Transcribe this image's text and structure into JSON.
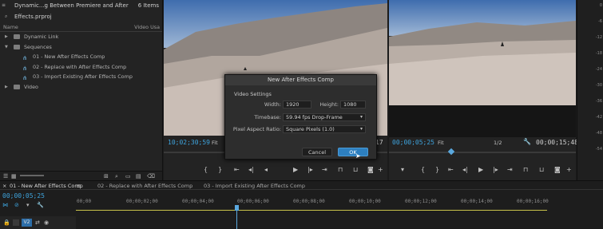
{
  "project": {
    "title": "Dynamic...g Between Premiere and After Effects.prproj",
    "item_count": "6 Items",
    "col_name": "Name",
    "col_usage": "Video Usa",
    "items": [
      {
        "label": "Dynamic Link"
      },
      {
        "label": "Sequences"
      },
      {
        "label": "01 - New After Effects Comp"
      },
      {
        "label": "02 - Replace with After Effects Comp"
      },
      {
        "label": "03 - Import Existing After Effects Comp"
      },
      {
        "label": "Video"
      }
    ]
  },
  "source_monitor": {
    "timecode": "10;02;30;59",
    "fit": "Fit",
    "tail": "17"
  },
  "program_monitor": {
    "timecode": "00;00;05;25",
    "fit": "Fit",
    "resolution": "1/2",
    "duration": "00;00;15;48"
  },
  "dialog": {
    "title": "New After Effects Comp",
    "section": "Video Settings",
    "width_label": "Width:",
    "width_value": "1920",
    "height_label": "Height:",
    "height_value": "1080",
    "timebase_label": "Timebase:",
    "timebase_value": "59.94 fps Drop-Frame",
    "par_label": "Pixel Aspect Ratio:",
    "par_value": "Square Pixels (1.0)",
    "cancel": "Cancel",
    "ok": "OK"
  },
  "timeline": {
    "tabs": [
      "01 - New After Effects Comp",
      "02 - Replace with After Effects Comp",
      "03 - Import Existing After Effects Comp"
    ],
    "timecode": "00;00;05;25",
    "ruler": [
      "00;00",
      "00;00;02;00",
      "00;00;04;00",
      "00;00;06;00",
      "00;00;08;00",
      "00;00;10;00",
      "00;00;12;00",
      "00;00;14;00",
      "00;00;16;00"
    ],
    "track": "V2"
  },
  "vu_labels": [
    "0",
    "-6",
    "-12",
    "-18",
    "-24",
    "-30",
    "-36",
    "-42",
    "-48",
    "-54"
  ],
  "colors": {
    "accent": "#3ea3dc",
    "ok_button": "#2d7fbf",
    "playhead": "#5aa8de"
  }
}
